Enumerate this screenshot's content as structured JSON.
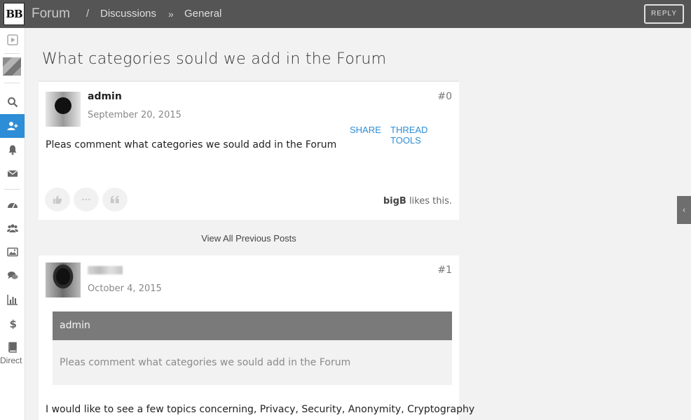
{
  "header": {
    "logo_text": "BB",
    "forum_label": "Forum",
    "separator_1": "/",
    "breadcrumb_discussions": "Discussions",
    "separator_2": "»",
    "breadcrumb_general": "General",
    "reply_label": "REPLY"
  },
  "sidebar": {
    "icons": [
      "play-icon",
      "avatar",
      "search-icon",
      "add-user-icon",
      "bell-icon",
      "envelope-icon",
      "dashboard-icon",
      "users-icon",
      "image-icon",
      "comments-icon",
      "bar-chart-icon",
      "dollar-icon",
      "book-icon"
    ],
    "active_item": "add-user-icon",
    "active_color": "#2d8dd6",
    "direct_label": "Direct"
  },
  "thread": {
    "title": "What categories sould we add in the Forum",
    "view_previous_label": "View All Previous Posts"
  },
  "posts": [
    {
      "author": "admin",
      "date": "September 20, 2015",
      "number": "#0",
      "share_label": "SHARE",
      "tools_label": "THREAD TOOLS",
      "body": "Pleas comment what categories we sould add in the Forum",
      "liker": "bigB",
      "likes_suffix": " likes this."
    },
    {
      "author": "",
      "date": "October 4, 2015",
      "number": "#1",
      "quote_author": "admin",
      "quote_text": "Pleas comment what categories we sould add in the Forum",
      "body": "I would like to see a few topics concerning, Privacy, Security, Anonymity, Cryptography"
    }
  ],
  "colors": {
    "topbar": "#555555",
    "link": "#2d8dd6",
    "quote_header": "#7a7a7a"
  }
}
